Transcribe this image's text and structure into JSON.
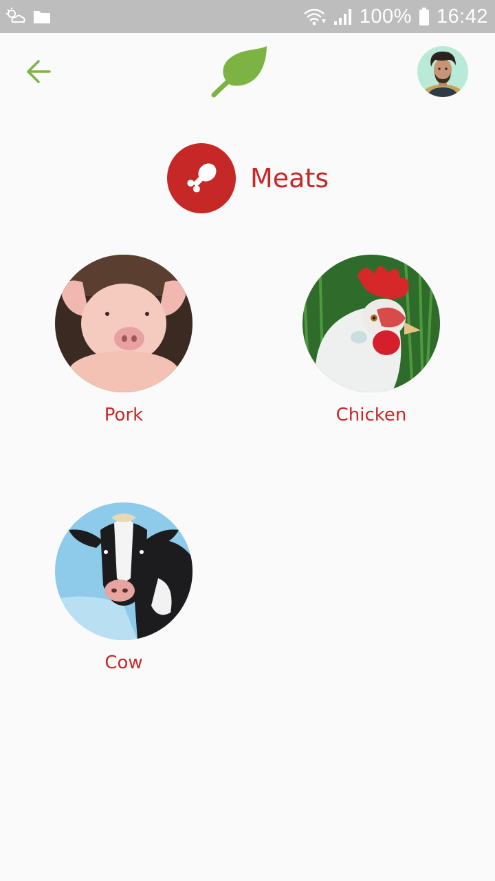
{
  "status_bar": {
    "battery": "100%",
    "time": "16:42",
    "icons": [
      "weather-icon",
      "folder-icon",
      "wifi-icon",
      "signal-icon",
      "battery-icon"
    ]
  },
  "app_bar": {
    "back_icon": "arrow-left-icon",
    "logo_icon": "leaf-icon",
    "avatar": "user-avatar"
  },
  "category": {
    "title": "Meats",
    "icon": "drumstick-icon"
  },
  "items": [
    {
      "label": "Pork",
      "image": "pig-photo"
    },
    {
      "label": "Chicken",
      "image": "chicken-photo"
    },
    {
      "label": "Cow",
      "image": "cow-photo"
    }
  ],
  "colors": {
    "accent_green": "#7cb342",
    "accent_red": "#c62828",
    "background": "#fafafa",
    "status_bar": "#bdbdbd"
  }
}
